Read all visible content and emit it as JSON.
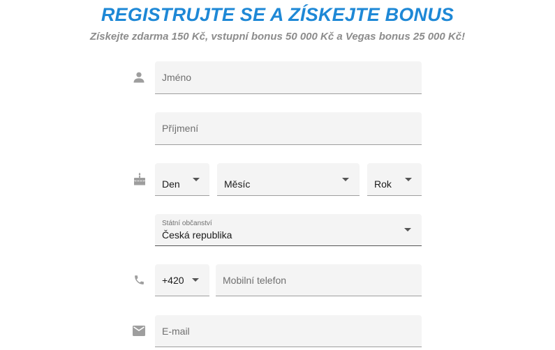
{
  "header": {
    "title": "REGISTRUJTE SE A ZÍSKEJTE BONUS",
    "subtitle": "Získejte zdarma 150 Kč, vstupní bonus 50 000 Kč a Vegas bonus 25 000 Kč!"
  },
  "form": {
    "first_name": {
      "placeholder": "Jméno",
      "icon": "person-icon"
    },
    "last_name": {
      "placeholder": "Příjmení"
    },
    "birth": {
      "icon": "cake-icon",
      "day_label": "Den",
      "month_label": "Měsíc",
      "year_label": "Rok"
    },
    "citizenship": {
      "label": "Státní občanství",
      "value": "Česká republika"
    },
    "phone": {
      "icon": "phone-icon",
      "prefix": "+420",
      "placeholder": "Mobilní telefon"
    },
    "email": {
      "icon": "email-icon",
      "placeholder": "E-mail"
    }
  },
  "colors": {
    "accent": "#1e88d6",
    "subtitle": "#8c8c8c",
    "field_bg": "#f4f4f4",
    "icon": "#9e9e9e"
  }
}
